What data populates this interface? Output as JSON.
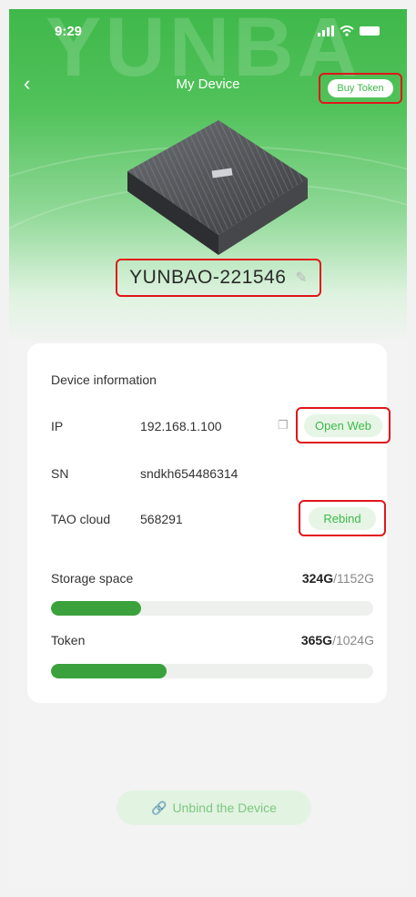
{
  "status": {
    "time": "9:29"
  },
  "nav": {
    "title": "My Device",
    "buy_token": "Buy Token"
  },
  "device": {
    "name": "YUNBAO-221546"
  },
  "info": {
    "title": "Device information",
    "ip_label": "IP",
    "ip_value": "192.168.1.100",
    "open_web": "Open Web",
    "sn_label": "SN",
    "sn_value": "sndkh654486314",
    "tao_label": "TAO cloud",
    "tao_value": "568291",
    "rebind": "Rebind"
  },
  "storage": {
    "label": "Storage space",
    "used": "324G",
    "total": "/1152G",
    "fraction": 0.28
  },
  "token": {
    "label": "Token",
    "used": "365G",
    "total": "/1024G",
    "fraction": 0.36
  },
  "unbind": {
    "label": "Unbind the Device"
  },
  "colors": {
    "accent": "#3fb84a",
    "highlight": "#e0161a"
  },
  "icons": {
    "back": "chevron-left-icon",
    "copy": "copy-icon",
    "edit": "edit-icon",
    "unbind": "link-icon"
  }
}
